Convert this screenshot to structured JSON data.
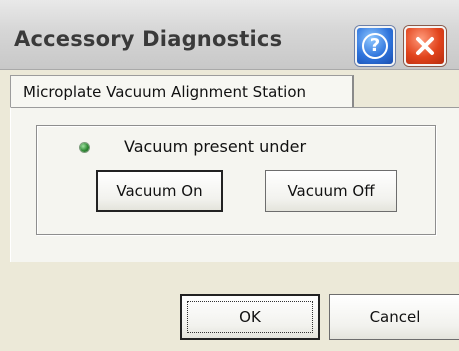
{
  "window": {
    "title": "Accessory Diagnostics",
    "help_icon": "help-icon",
    "close_icon": "close-icon"
  },
  "tabs": [
    {
      "label": "Microplate Vacuum Alignment Station",
      "selected": true
    }
  ],
  "vacuum_group": {
    "status_indicator_color": "#2f8a34",
    "status_text": "Vacuum present under",
    "vacuum_on_label": "Vacuum On",
    "vacuum_off_label": "Vacuum Off"
  },
  "footer": {
    "ok_label": "OK",
    "cancel_label": "Cancel"
  },
  "colors": {
    "close_red": "#e1431c",
    "help_blue": "#2f74dc",
    "dialog_bg": "#ece9d8"
  }
}
